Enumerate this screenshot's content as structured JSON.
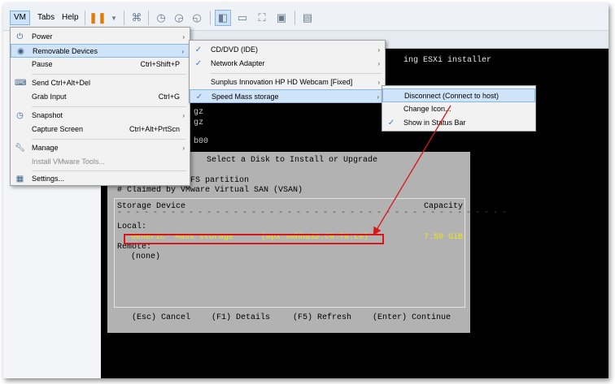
{
  "menubar": {
    "items": [
      "VM",
      "Tabs",
      "Help"
    ]
  },
  "console": {
    "lines": [
      "ing ESXi installer",
      "gz",
      "gz",
      "b00"
    ]
  },
  "dialog": {
    "title": "Select a Disk to Install or Upgrade",
    "note1": "* Contains a VMFS partition",
    "note2": "# Claimed by VMware Virtual SAN (VSAN)",
    "col_device": "Storage Device",
    "col_capacity": "Capacity",
    "local_label": "Local:",
    "device_name": "Generic  Mass storage",
    "device_id": "(mpx.vmhba32:C0:T0:L0)",
    "device_capacity": "7.50 GiB",
    "remote_label": "Remote:",
    "remote_value": "(none)",
    "footer": {
      "cancel": "(Esc) Cancel",
      "details": "(F1) Details",
      "refresh": "(F5) Refresh",
      "continue": "(Enter) Continue"
    }
  },
  "vm_menu": {
    "items": [
      {
        "label": "Power",
        "icon": "power-icon",
        "submenu": true
      },
      {
        "label": "Removable Devices",
        "icon": "disc-icon",
        "submenu": true,
        "highlighted": true
      },
      {
        "label": "Pause",
        "shortcut": "Ctrl+Shift+P"
      },
      {
        "label": "Send Ctrl+Alt+Del",
        "icon": "keyboard-icon"
      },
      {
        "label": "Grab Input",
        "shortcut": "Ctrl+G"
      },
      {
        "label": "Snapshot",
        "icon": "snapshot-icon",
        "submenu": true
      },
      {
        "label": "Capture Screen",
        "shortcut": "Ctrl+Alt+PrtScn"
      },
      {
        "label": "Manage",
        "icon": "wrench-icon",
        "submenu": true
      },
      {
        "label": "Install VMware Tools...",
        "disabled": true
      },
      {
        "label": "Settings...",
        "icon": "settings-icon"
      }
    ]
  },
  "devices_menu": {
    "items": [
      {
        "label": "CD/DVD (IDE)",
        "checked": true
      },
      {
        "label": "Network Adapter",
        "checked": true
      },
      {
        "label": "Sunplus Innovation HP HD Webcam [Fixed]",
        "checked": false
      },
      {
        "label": "Speed Mass storage",
        "checked": true,
        "highlighted": true
      }
    ]
  },
  "storage_menu": {
    "items": [
      {
        "label": "Disconnect (Connect to host)",
        "highlighted": true
      },
      {
        "label": "Change Icon..."
      },
      {
        "label": "Show in Status Bar",
        "checked": true
      }
    ]
  },
  "colors": {
    "highlight": "#cfe4f8",
    "callout_red": "#d9161a",
    "installer_gray": "#b2b2b2",
    "device_yellow": "#f2e21c"
  }
}
